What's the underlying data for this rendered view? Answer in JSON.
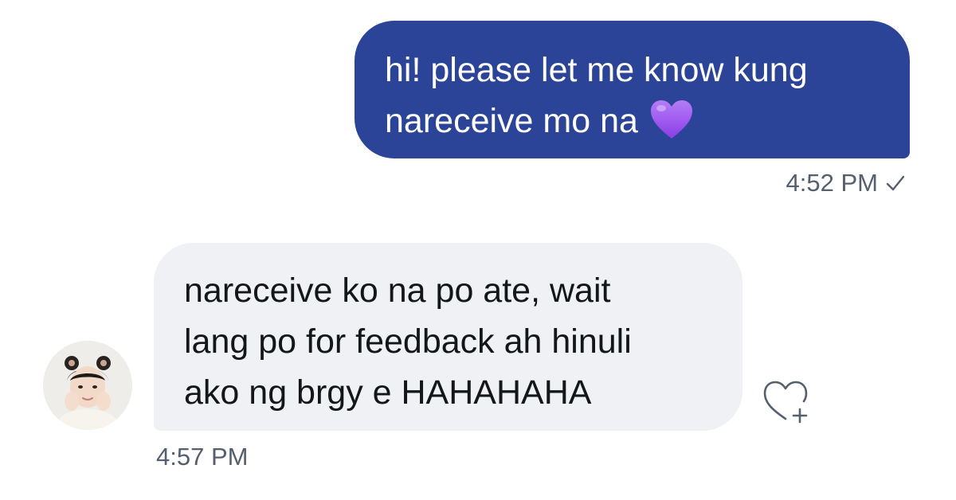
{
  "conversation": {
    "sent_message": {
      "text": "hi! please let me know kung\nnareceive mo na",
      "emoji": "purple-heart",
      "time": "4:52 PM",
      "status": "read-check",
      "bubble_color": "#2c4497"
    },
    "received_message": {
      "text": "nareceive ko na po ate, wait\nlang po for feedback ah hinuli\nako ng brgy e HAHAHAHA",
      "time": "4:57 PM",
      "bubble_color": "#eff1f4"
    }
  },
  "icons": {
    "check": "check-icon",
    "react": "heart-plus-icon",
    "emoji": "purple-heart-emoji"
  },
  "colors": {
    "sent_text": "#ffffff",
    "received_text": "#14171a",
    "timestamp": "#54606e",
    "emoji": "#a05cf2"
  }
}
